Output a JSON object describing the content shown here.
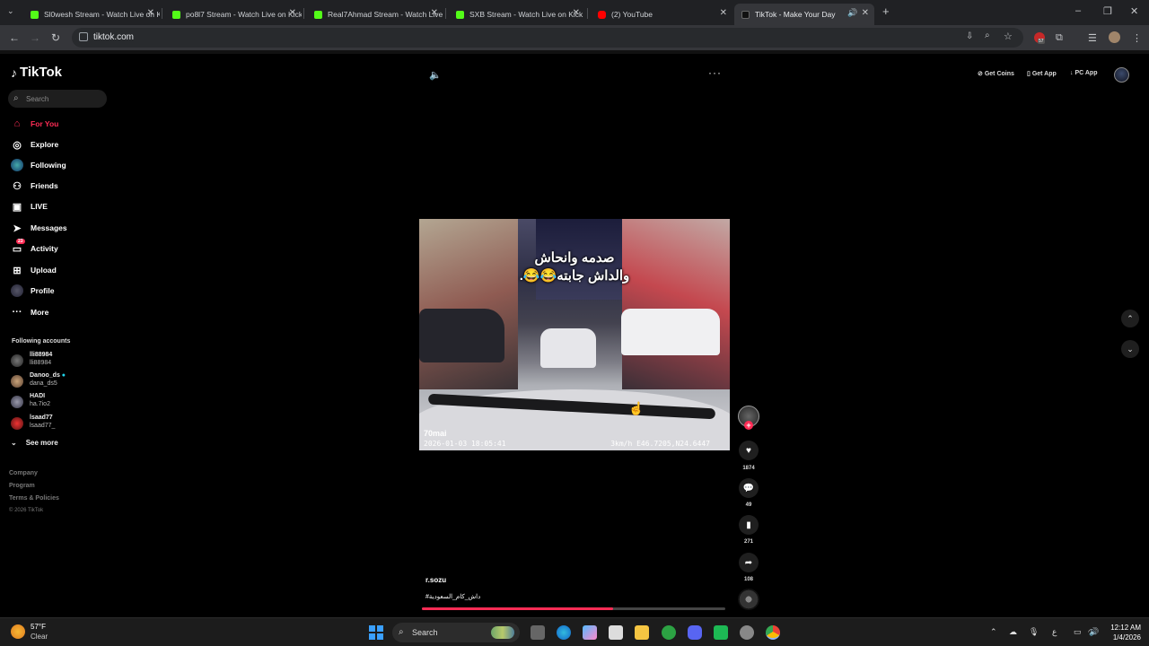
{
  "browser": {
    "tabs": [
      {
        "title": "Sl0wesh Stream - Watch Live on Kick",
        "favicon_color": "#53fc18"
      },
      {
        "title": "po8l7 Stream - Watch Live on Kick",
        "favicon_color": "#53fc18"
      },
      {
        "title": "Real7Ahmad Stream - Watch Live on Kick",
        "favicon_color": "#53fc18"
      },
      {
        "title": "SXB Stream - Watch Live on Kick",
        "favicon_color": "#53fc18"
      },
      {
        "title": "(2) YouTube",
        "favicon_color": "#ff0000"
      },
      {
        "title": "TikTok - Make Your Day",
        "favicon_color": "#ffffff",
        "active": true
      }
    ],
    "url": "tiktok.com",
    "extension_badge": "57"
  },
  "sidebar": {
    "logo": "TikTok",
    "search_placeholder": "Search",
    "nav": [
      {
        "label": "For You",
        "icon": "home-icon",
        "active": true
      },
      {
        "label": "Explore",
        "icon": "compass-icon"
      },
      {
        "label": "Following",
        "icon": "following-icon"
      },
      {
        "label": "Friends",
        "icon": "friends-icon"
      },
      {
        "label": "LIVE",
        "icon": "live-icon"
      },
      {
        "label": "Messages",
        "icon": "messages-icon"
      },
      {
        "label": "Activity",
        "icon": "activity-icon",
        "badge": "23"
      },
      {
        "label": "Upload",
        "icon": "upload-icon"
      },
      {
        "label": "Profile",
        "icon": "profile-icon"
      },
      {
        "label": "More",
        "icon": "more-icon"
      }
    ],
    "following_title": "Following accounts",
    "accounts": [
      {
        "name": "lli88984",
        "handle": "lli88984"
      },
      {
        "name": "Danoo_ds",
        "handle": "dana_ds5"
      },
      {
        "name": "HADI",
        "handle": "ha.7io2"
      },
      {
        "name": "lsaad77",
        "handle": "lsaad77_"
      }
    ],
    "see_more": "See more",
    "footer": [
      "Company",
      "Program",
      "Terms & Policies",
      "© 2026 TikTok"
    ]
  },
  "top_actions": {
    "get_coins": "Get Coins",
    "get_app": "Get App",
    "pc_app": "PC App"
  },
  "video": {
    "caption_line1": "صدمه وانحاش",
    "caption_line2": "والداش جابته😂😂.",
    "cam_brand": "70mai",
    "timestamp": "2026-01-03 18:05:41",
    "speed_gps": "3km/h E46.7205,N24.6447",
    "author": "r.sozu",
    "hashtag": "#داش_كام_السعودية",
    "progress": 0.63
  },
  "actions": {
    "likes": "1874",
    "comments": "49",
    "saves": "271",
    "shares": "108"
  },
  "taskbar": {
    "temperature": "57°F",
    "condition": "Clear",
    "search_label": "Search",
    "time": "12:12 AM",
    "date": "1/4/2026"
  },
  "colors": {
    "accent": "#fe2c55",
    "kick_green": "#53fc18"
  }
}
